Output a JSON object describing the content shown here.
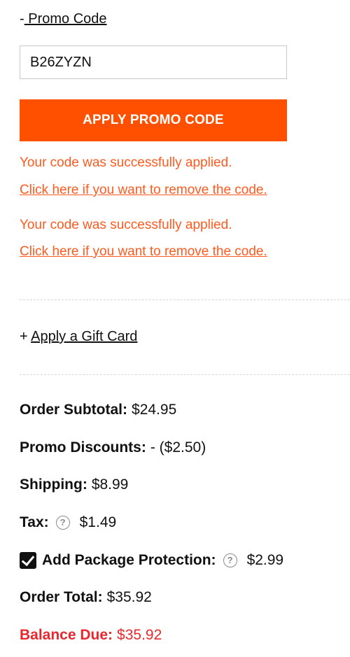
{
  "promo": {
    "toggle_prefix": "-",
    "toggle_label": " Promo Code",
    "input_value": "B26ZYZN",
    "apply_label": "APPLY PROMO CODE",
    "messages": [
      {
        "success": "Your code was successfully applied.",
        "remove_link": "Click here if you want to remove the code."
      },
      {
        "success": "Your code was successfully applied.",
        "remove_link": "Click here if you want to remove the code."
      }
    ]
  },
  "gift_card": {
    "toggle_prefix": "+",
    "toggle_label": "Apply a Gift Card"
  },
  "summary": {
    "subtotal_label": "Order Subtotal:",
    "subtotal_value": "$24.95",
    "discount_label": "Promo Discounts:",
    "discount_value": "- ($2.50)",
    "shipping_label": "Shipping:",
    "shipping_value": "$8.99",
    "tax_label": "Tax:",
    "tax_value": "$1.49",
    "protection_label": "Add Package Protection:",
    "protection_value": "$2.99",
    "protection_checked": true,
    "total_label": "Order Total:",
    "total_value": "$35.92",
    "balance_label": "Balance Due:",
    "balance_value": "$35.92"
  },
  "icons": {
    "help": "question-circle-icon",
    "checkbox": "checkbox-checked-icon",
    "help_glyph": "?"
  },
  "colors": {
    "accent": "#ff5000",
    "message": "#ff5a1f",
    "balance": "#e8282e"
  }
}
